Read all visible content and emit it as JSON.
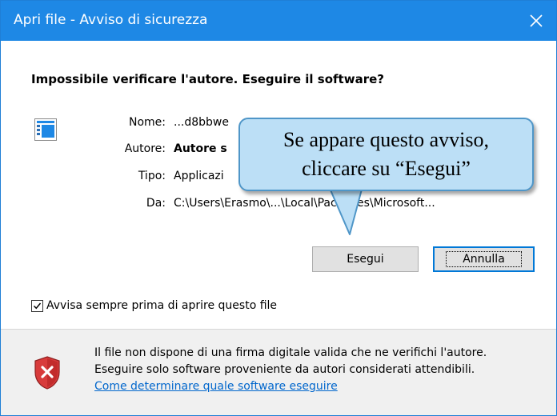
{
  "window": {
    "title": "Apri file - Avviso di sicurezza",
    "close_icon": "close-icon"
  },
  "dialog": {
    "heading": "Impossibile verificare l'autore. Eseguire il software?",
    "fields": [
      {
        "label": "Nome:",
        "value": "...d8bbwe"
      },
      {
        "label": "Autore:",
        "value": "Autore s"
      },
      {
        "label": "Tipo:",
        "value": "Applicazi"
      },
      {
        "label": "Da:",
        "value": "C:\\Users\\Erasmo\\...\\Local\\Packages\\Microsoft..."
      }
    ],
    "buttons": {
      "run": "Esegui",
      "cancel": "Annulla"
    },
    "checkbox": {
      "label": "Avvisa sempre prima di aprire questo file",
      "checked": true
    }
  },
  "footer": {
    "warning_line1": "Il file non dispone di una firma digitale valida che ne verifichi l'autore.",
    "warning_line2": "Eseguire solo software proveniente da autori considerati attendibili.",
    "link": "Come determinare quale software eseguire"
  },
  "callout": {
    "line1": "Se appare questo avviso,",
    "line2": "cliccare su “Esegui”"
  },
  "colors": {
    "titlebar": "#1e88e5",
    "callout_fill": "#bcdff6",
    "callout_border": "#4f96c8",
    "link": "#0066cc",
    "shield": "#d83b3b"
  }
}
